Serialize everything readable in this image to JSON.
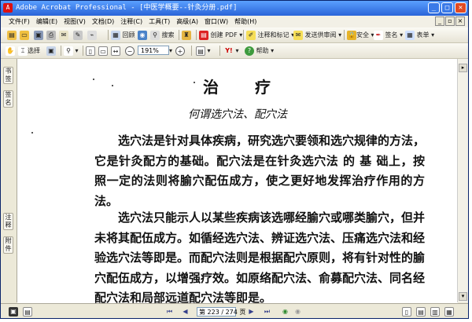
{
  "window": {
    "title": "Adobe Acrobat Professional - [中医学概要--针灸分册.pdf]",
    "app_icon": "acrobat-icon",
    "controls": [
      "_",
      "□",
      "✕"
    ]
  },
  "menu": {
    "items": [
      "文件(F)",
      "编辑(E)",
      "视图(V)",
      "文档(D)",
      "注释(C)",
      "工具(T)",
      "高级(A)",
      "窗口(W)",
      "帮助(H)"
    ]
  },
  "toolbar1": {
    "print_label": "",
    "organizer_label": "回顾",
    "search_label": "搜索",
    "create_pdf_label": "创建 PDF",
    "comment_label": "注释和标记",
    "send_review_label": "发送供审阅",
    "secure_label": "安全",
    "sign_label": "签名",
    "forms_label": "表单"
  },
  "toolbar2": {
    "select_label": "选择",
    "zoom_value": "191%",
    "help_label": "帮助"
  },
  "sidebar": {
    "tabs": [
      "书签",
      "签名",
      "注释",
      "附件"
    ]
  },
  "document": {
    "title": "治　　疗",
    "subtitle": "何谓选穴法、配穴法",
    "paragraph1": "选穴法是针对具体疾病，研究选穴要领和选穴规律的方法，它是针灸配方的基础。配穴法是在针灸选穴法 的 基 础上，按照一定的法则将腧穴配伍成方，使之更好地发挥治疗作用的方法。",
    "paragraph2": "选穴法只能示人以某些疾病该选哪经腧穴或哪类腧穴，但并未将其配伍成方。如循经选穴法、辨证选穴法、压痛选穴法和经验选穴法等即是。而配穴法则是根据配穴原则，将有针对性的腧穴配伍成方，以增强疗效。如原络配穴法、俞募配穴法、同名经配穴法和局部远道配穴法等即是。"
  },
  "status": {
    "page_indicator": "第 223 / 274 页"
  },
  "colors": {
    "titlebar": "#2a64d8",
    "close": "#e04a22"
  }
}
